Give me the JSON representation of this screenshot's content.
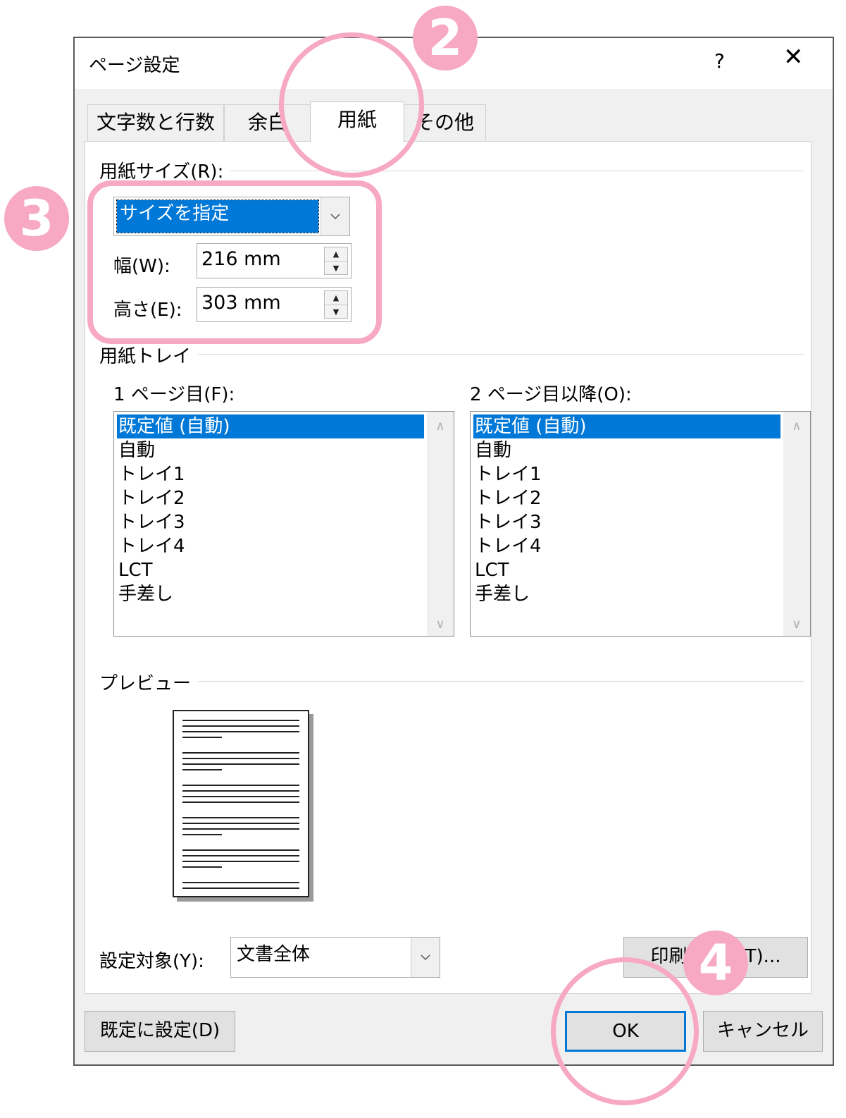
{
  "dialog": {
    "title": "ページ設定",
    "help_label": "?",
    "close_label": "✕"
  },
  "tabs": [
    {
      "label": "文字数と行数"
    },
    {
      "label": "余白"
    },
    {
      "label": "用紙"
    },
    {
      "label": "その他"
    }
  ],
  "paper_size": {
    "group_label": "用紙サイズ(R):",
    "selected": "サイズを指定",
    "width_label": "幅(W):",
    "width_value": "216 mm",
    "height_label": "高さ(E):",
    "height_value": "303 mm"
  },
  "paper_tray": {
    "group_label": "用紙トレイ",
    "first_page_label": "1 ページ目(F):",
    "other_pages_label": "2 ページ目以降(O):",
    "items": [
      "既定値 (自動)",
      "自動",
      "トレイ1",
      "トレイ2",
      "トレイ3",
      "トレイ4",
      "LCT",
      "手差し"
    ]
  },
  "preview": {
    "group_label": "プレビュー"
  },
  "apply_to": {
    "label": "設定対象(Y):",
    "value": "文書全体"
  },
  "buttons": {
    "print_options": "印刷オ",
    "print_options_tail": "(T)...",
    "set_default": "既定に設定(D)",
    "ok": "OK",
    "cancel": "キャンセル"
  },
  "annotations": {
    "badge2": "2",
    "badge3": "3",
    "badge4": "4",
    "color": "#f7a8c3"
  },
  "colors": {
    "selection": "#0078d7",
    "dialog_bg": "#f0f0f0"
  }
}
